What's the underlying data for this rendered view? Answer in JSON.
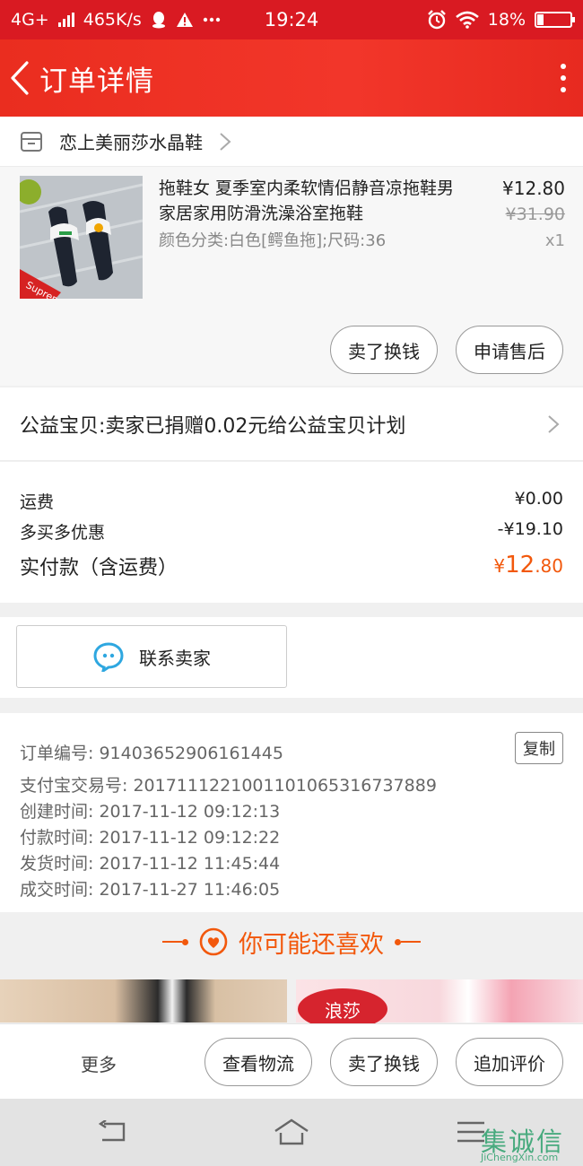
{
  "status_bar": {
    "network": "4G+",
    "speed": "465K/s",
    "time": "19:24",
    "battery": "18%",
    "battery_level": 0.18
  },
  "header": {
    "title": "订单详情"
  },
  "shop": {
    "name": "恋上美丽莎水晶鞋"
  },
  "item": {
    "title": "拖鞋女 夏季室内柔软情侣静音凉拖鞋男家居家用防滑洗澡浴室拖鞋",
    "spec": "颜色分类:白色[鳄鱼拖];尺码:36",
    "price": "¥12.80",
    "original_price": "¥31.90",
    "quantity": "x1",
    "image_brand": "Supreme",
    "buttons": {
      "sell": "卖了换钱",
      "after_sale": "申请售后"
    }
  },
  "charity": {
    "text": "公益宝贝:卖家已捐赠0.02元给公益宝贝计划"
  },
  "fees": {
    "shipping_label": "运费",
    "shipping_value": "¥0.00",
    "discount_label": "多买多优惠",
    "discount_value": "-¥19.10",
    "total_label": "实付款（含运费）",
    "total_symbol": "¥",
    "total_integer": "12",
    "total_decimal": ".80"
  },
  "contact": {
    "label": "联系卖家"
  },
  "order_info": {
    "copy_label": "复制",
    "rows": [
      "订单编号: 91403652906161445",
      "支付宝交易号: 2017111221001101065316737889",
      "创建时间: 2017-11-12 09:12:13",
      "付款时间: 2017-11-12 09:12:22",
      "发货时间: 2017-11-12 11:45:44",
      "成交时间: 2017-11-27 11:46:05"
    ]
  },
  "recommend": {
    "title": "你可能还喜欢",
    "brand_logo": "浪莎"
  },
  "bottom_bar": {
    "more": "更多",
    "logistics": "查看物流",
    "sell": "卖了换钱",
    "review": "追加评价"
  },
  "watermark": {
    "main": "集诚信",
    "sub": "JiChengXin.com"
  },
  "colors": {
    "brand_red": "#e8281d",
    "price_orange": "#f2580c",
    "contact_blue": "#2ea7e0",
    "watermark_green": "#1d9b62"
  }
}
